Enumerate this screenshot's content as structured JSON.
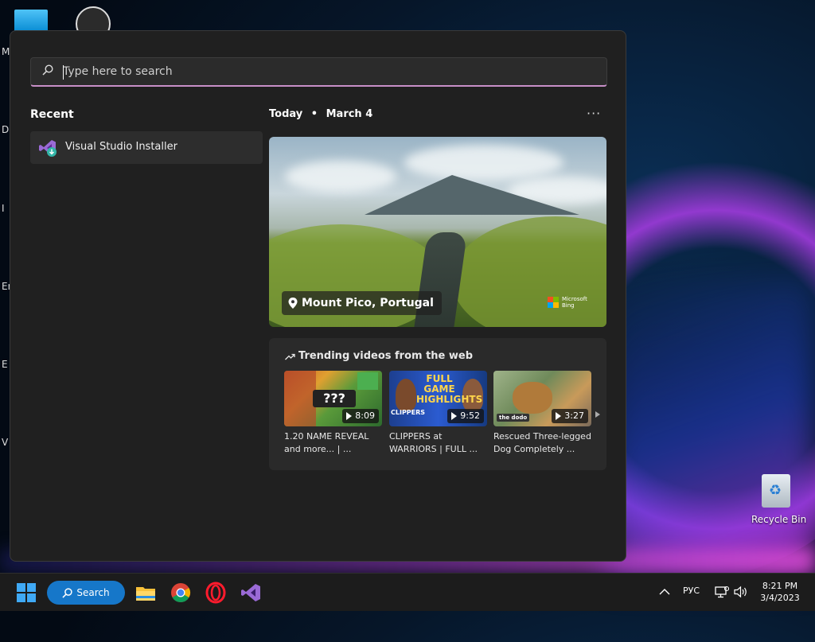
{
  "desktop": {
    "left_letters": [
      "M",
      "Da",
      "I",
      "Er",
      "E",
      "V"
    ],
    "recycle_bin_label": "Recycle Bin"
  },
  "start_menu": {
    "search": {
      "placeholder": "Type here to search",
      "value": ""
    },
    "recent": {
      "title": "Recent",
      "items": [
        {
          "label": "Visual Studio Installer",
          "icon": "visual-studio-installer-icon"
        }
      ]
    },
    "today": {
      "label": "Today",
      "separator": "•",
      "date": "March 4",
      "more_label": "···"
    },
    "hero": {
      "caption": "Mount Pico, Portugal",
      "brand_line1": "Microsoft",
      "brand_line2": "Bing"
    },
    "trending": {
      "title": "Trending videos from the web",
      "videos": [
        {
          "title": "1.20 NAME REVEAL and more... | ...",
          "duration": "8:09",
          "thumb_text": "???"
        },
        {
          "title": "CLIPPERS at WARRIORS | FULL ...",
          "duration": "9:52",
          "thumb_text_1": "FULL GAME",
          "thumb_text_2": "HIGHLIGHTS",
          "thumb_text_3": "CLIPPERS"
        },
        {
          "title": "Rescued Three-legged Dog Completely ...",
          "duration": "3:27",
          "thumb_text": "the dodo"
        }
      ]
    }
  },
  "taskbar": {
    "search_label": "Search",
    "apps": [
      "file-explorer-icon",
      "chrome-icon",
      "opera-icon",
      "visual-studio-icon"
    ],
    "language": "РУС",
    "time": "8:21 PM",
    "date": "3/4/2023"
  },
  "colors": {
    "panel_bg": "#202020",
    "search_accent": "#c890c8",
    "taskbar_search": "#1677c9",
    "windows_blue": "#3fa9f5"
  }
}
